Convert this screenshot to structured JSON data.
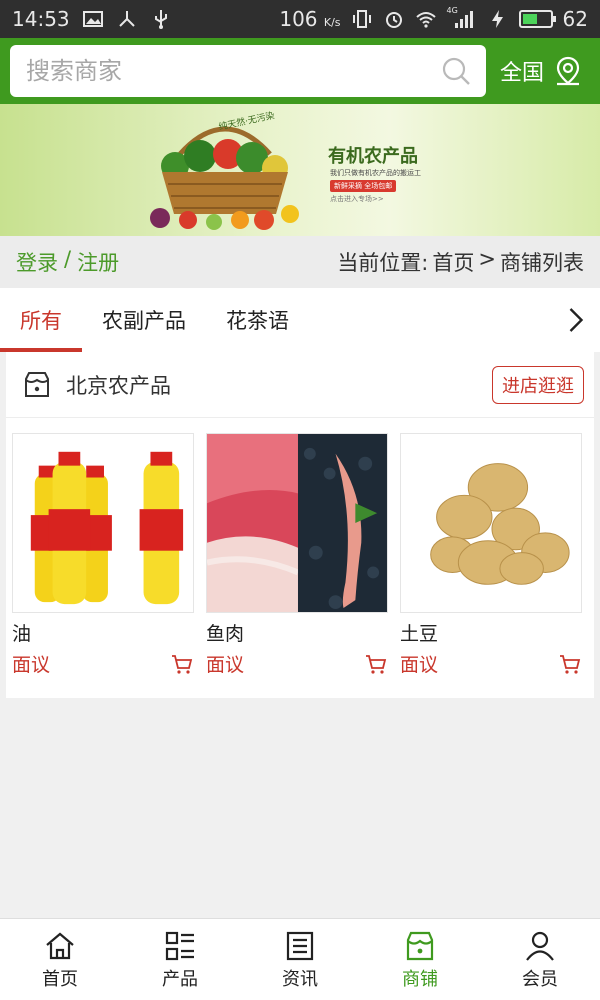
{
  "status": {
    "time": "14:53",
    "speed": "106",
    "speed_unit": "K/s",
    "network": "4G",
    "battery": "62",
    "battery_level": 0.62
  },
  "search": {
    "placeholder": "搜索商家"
  },
  "region": {
    "label": "全国"
  },
  "banner": {
    "title": "有机农产品",
    "tagline": "纯天然·无污染",
    "subtitle": "我们只做有机农产品的搬运工",
    "chip": "新鲜采摘 全场包邮",
    "more": "点击进入专场>>"
  },
  "auth": {
    "login": "登录",
    "separator": "/",
    "register": "注册"
  },
  "location": {
    "prefix": "当前位置:",
    "home": "首页",
    "sep": ">",
    "current": "商铺列表"
  },
  "tabs": [
    {
      "label": "所有"
    },
    {
      "label": "农副产品"
    },
    {
      "label": "花茶语"
    }
  ],
  "shop": {
    "name": "北京农产品",
    "visit_label": "进店逛逛",
    "products": [
      {
        "name": "油",
        "price": "面议"
      },
      {
        "name": "鱼肉",
        "price": "面议"
      },
      {
        "name": "土豆",
        "price": "面议"
      }
    ]
  },
  "nav": [
    {
      "label": "首页",
      "icon": "home-icon"
    },
    {
      "label": "产品",
      "icon": "grid-list-icon"
    },
    {
      "label": "资讯",
      "icon": "news-icon"
    },
    {
      "label": "商铺",
      "icon": "store-icon"
    },
    {
      "label": "会员",
      "icon": "user-icon"
    }
  ],
  "colors": {
    "brand_green": "#3f9a1f",
    "accent_red": "#c9372c"
  }
}
